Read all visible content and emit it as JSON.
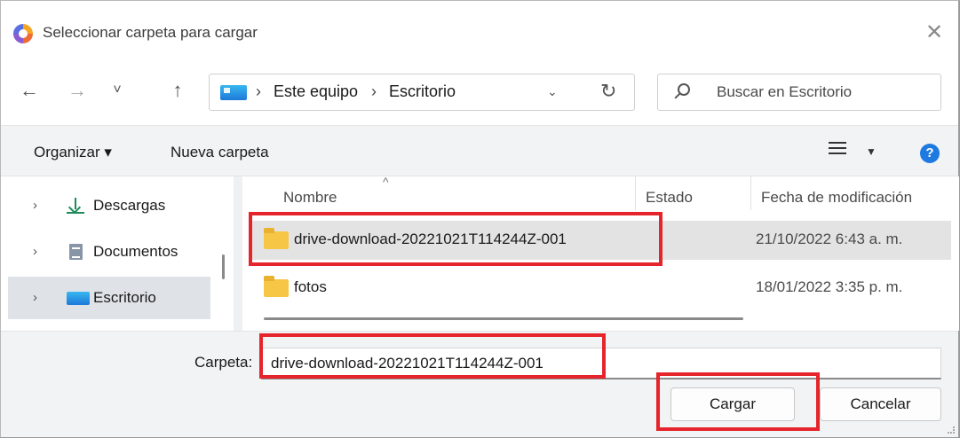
{
  "window": {
    "title": "Seleccionar carpeta para cargar",
    "close_glyph": "✕"
  },
  "nav": {
    "back_glyph": "←",
    "forward_glyph": "→",
    "recent_glyph": "˅",
    "up_glyph": "↑",
    "breadcrumb": [
      "Este equipo",
      "Escritorio"
    ],
    "separator": "›",
    "dropdown_glyph": "⌄",
    "refresh_glyph": "↻",
    "search_placeholder": "Buscar en Escritorio"
  },
  "toolbar": {
    "organize": "Organizar ▾",
    "new_folder": "Nueva carpeta",
    "view_drop": "▼",
    "help": "?"
  },
  "sidebar": {
    "chevron": "›",
    "items": [
      {
        "label": "Descargas",
        "icon": "download-icon",
        "selected": false
      },
      {
        "label": "Documentos",
        "icon": "documents-icon",
        "selected": false
      },
      {
        "label": "Escritorio",
        "icon": "desktop-icon",
        "selected": true
      }
    ]
  },
  "filelist": {
    "sort_glyph": "^",
    "columns": [
      "Nombre",
      "Estado",
      "Fecha de modificación"
    ],
    "rows": [
      {
        "name": "drive-download-20221021T114244Z-001",
        "status": "",
        "modified": "21/10/2022 6:43 a. m.",
        "selected": true
      },
      {
        "name": "fotos",
        "status": "",
        "modified": "18/01/2022 3:35 p. m.",
        "selected": false
      }
    ]
  },
  "footer": {
    "folder_label": "Carpeta:",
    "folder_value": "drive-download-20221021T114244Z-001",
    "primary_button": "Cargar",
    "cancel_button": "Cancelar"
  },
  "colors": {
    "annotation_red": "#e5242b",
    "accent_blue": "#1e7ae0",
    "folder_yellow": "#f6c646"
  }
}
